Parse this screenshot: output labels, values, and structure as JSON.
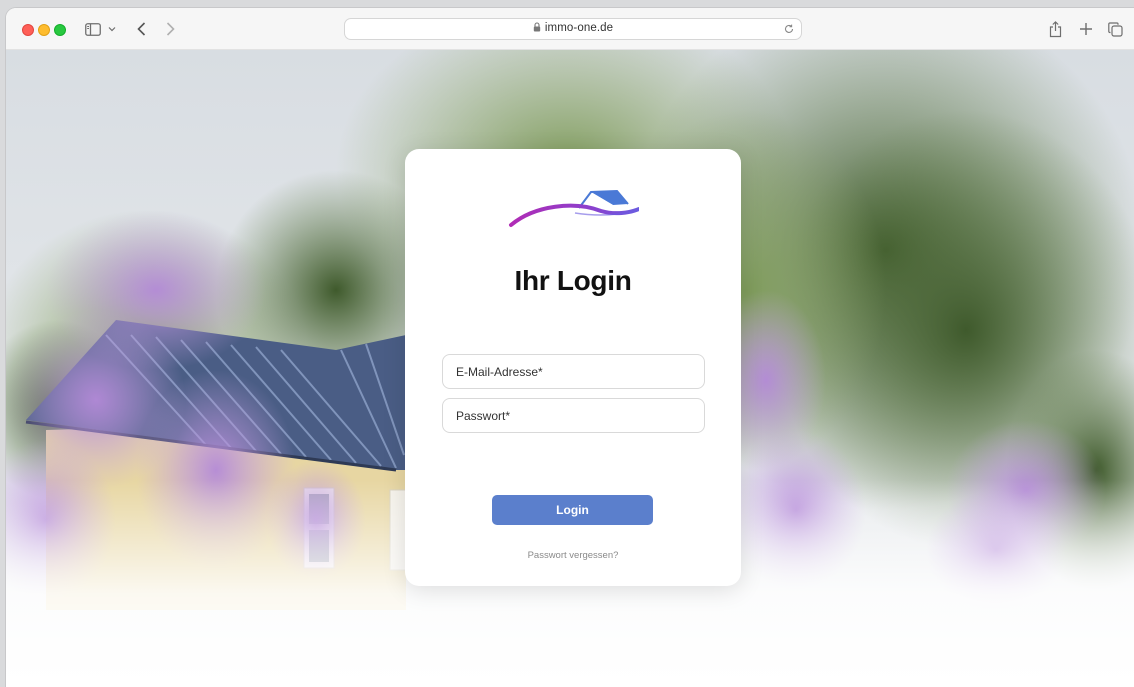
{
  "browser": {
    "url": "immo-one.de",
    "icons": [
      "sidebar-icon",
      "chevron-down-icon",
      "back-icon",
      "forward-icon",
      "lock-icon",
      "reload-icon",
      "share-icon",
      "new-tab-icon",
      "tabs-overview-icon"
    ]
  },
  "login": {
    "title": "Ihr Login",
    "email_placeholder": "E-Mail-Adresse*",
    "password_placeholder": "Passwort*",
    "submit_label": "Login",
    "forgot_label": "Passwort vergessen?"
  },
  "colors": {
    "accent_button": "#5b7fcc",
    "logo_roof": "#4a79d6",
    "logo_swoosh_start": "#b02cb5",
    "logo_swoosh_end": "#6b5be0"
  }
}
